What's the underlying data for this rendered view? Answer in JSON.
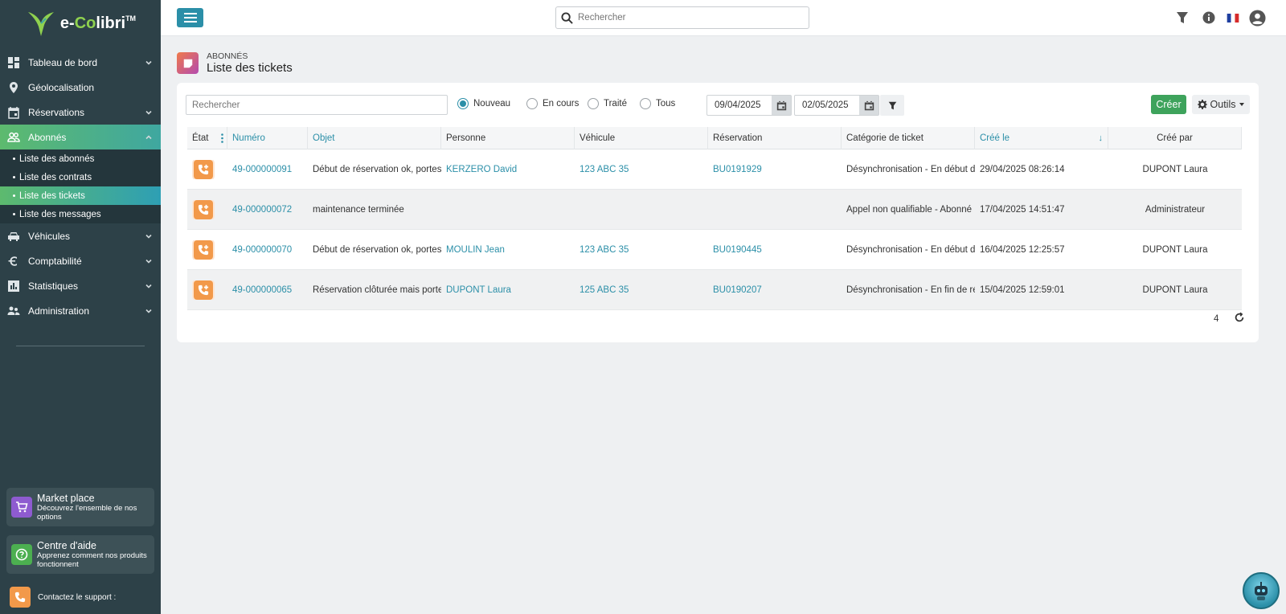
{
  "brand": {
    "name_prefix": "e-",
    "name_co": "Co",
    "name_suffix": "libri",
    "tm": "TM"
  },
  "sidebar": {
    "items": [
      {
        "label": "Tableau de bord",
        "icon": "dashboard-icon",
        "has_children": true
      },
      {
        "label": "Géolocalisation",
        "icon": "location-pin-icon",
        "has_children": false
      },
      {
        "label": "Réservations",
        "icon": "calendar-icon",
        "has_children": true
      },
      {
        "label": "Abonnés",
        "icon": "users-icon",
        "has_children": true,
        "active": true
      },
      {
        "label": "Véhicules",
        "icon": "car-icon",
        "has_children": true
      },
      {
        "label": "Comptabilité",
        "icon": "euro-icon",
        "has_children": true
      },
      {
        "label": "Statistiques",
        "icon": "bar-chart-icon",
        "has_children": true
      },
      {
        "label": "Administration",
        "icon": "admin-users-icon",
        "has_children": true
      }
    ],
    "subitems": [
      {
        "label": "Liste des abonnés"
      },
      {
        "label": "Liste des contrats"
      },
      {
        "label": "Liste des tickets",
        "active": true
      },
      {
        "label": "Liste des messages"
      }
    ],
    "market": {
      "title": "Market place",
      "desc": "Découvrez l'ensemble de nos options",
      "color": "#8e5bd0"
    },
    "help": {
      "title": "Centre d'aide",
      "desc": "Apprenez comment nos produits fonctionnent",
      "color": "#4caf50"
    },
    "support": {
      "label": "Contactez le support :"
    }
  },
  "topbar": {
    "search_placeholder": "Rechercher"
  },
  "page": {
    "breadcrumb": "ABONNÉS",
    "title": "Liste des tickets"
  },
  "filters": {
    "search_placeholder": "Rechercher",
    "radios": [
      {
        "label": "Nouveau",
        "checked": true
      },
      {
        "label": "En cours",
        "checked": false
      },
      {
        "label": "Traité",
        "checked": false
      },
      {
        "label": "Tous",
        "checked": false
      }
    ],
    "date_from": "09/04/2025",
    "date_to": "02/05/2025",
    "create_label": "Créer",
    "tools_label": "Outils"
  },
  "table": {
    "columns": [
      "État",
      "Numéro",
      "Objet",
      "Personne",
      "Véhicule",
      "Réservation",
      "Catégorie de ticket",
      "Créé le",
      "Créé par"
    ],
    "rows": [
      {
        "numero": "49-000000091",
        "objet": "Début de réservation ok, portes",
        "personne": "KERZERO David",
        "vehicule": "123 ABC 35",
        "reservation": "BU0191929",
        "categorie": "Désynchronisation - En début de",
        "cree_le": "29/04/2025 08:26:14",
        "cree_par": "DUPONT Laura"
      },
      {
        "numero": "49-000000072",
        "objet": "maintenance terminée",
        "personne": "",
        "vehicule": "",
        "reservation": "",
        "categorie": "Appel non qualifiable - Abonné r",
        "cree_le": "17/04/2025 14:51:47",
        "cree_par": "Administrateur"
      },
      {
        "numero": "49-000000070",
        "objet": "Début de réservation ok, portes",
        "personne": "MOULIN Jean",
        "vehicule": "123 ABC 35",
        "reservation": "BU0190445",
        "categorie": "Désynchronisation - En début de",
        "cree_le": "16/04/2025 12:25:57",
        "cree_par": "DUPONT Laura"
      },
      {
        "numero": "49-000000065",
        "objet": "Réservation clôturée mais portes",
        "personne": "DUPONT Laura",
        "vehicule": "125 ABC 35",
        "reservation": "BU0190207",
        "categorie": "Désynchronisation - En fin de rés",
        "cree_le": "15/04/2025 12:59:01",
        "cree_par": "DUPONT Laura"
      }
    ],
    "count": "4"
  },
  "colors": {
    "accent": "#2b8fa8",
    "sidebar_bg": "#2d4148",
    "create_green": "#3ea35c",
    "state_orange": "#f2994a"
  }
}
